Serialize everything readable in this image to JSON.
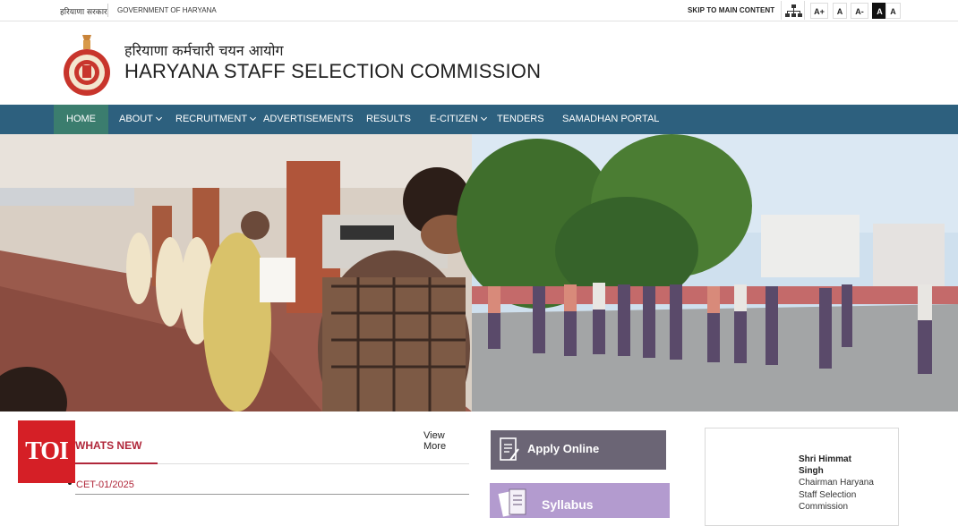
{
  "topbar": {
    "gov_hindi": "हरियाणा सरकार",
    "gov_english": "GOVERNMENT OF HARYANA",
    "skip_link": "SKIP TO MAIN CONTENT",
    "font_increase": "A+",
    "font_normal": "A",
    "font_decrease": "A-",
    "contrast_dark": "A",
    "contrast_light": "A"
  },
  "header": {
    "title_hindi": "हरियाणा कर्मचारी चयन आयोग",
    "title_english": "HARYANA STAFF SELECTION COMMISSION"
  },
  "nav": {
    "items": [
      {
        "label": "HOME",
        "active": true
      },
      {
        "label": "ABOUT",
        "dropdown": true
      },
      {
        "label": "RECRUITMENT",
        "dropdown": true
      },
      {
        "label": "ADVERTISEMENTS"
      },
      {
        "label": "RESULTS"
      },
      {
        "label": "E-CITIZEN",
        "dropdown": true
      },
      {
        "label": "TENDERS"
      },
      {
        "label": "SAMADHAN PORTAL"
      }
    ]
  },
  "banner": {
    "controls": [
      "prev-icon",
      "pause-icon",
      "next-icon"
    ]
  },
  "news": {
    "title": "WHATS NEW",
    "view_more": "View More",
    "items": [
      "CET-01/2025"
    ]
  },
  "overlay_badge": "TOI",
  "tiles": {
    "apply_online": "Apply Online",
    "syllabus": "Syllabus"
  },
  "chairman": {
    "name": "Shri Himmat Singh",
    "role": "Chairman Haryana Staff Selection Commission"
  },
  "colors": {
    "nav_bg": "#2d607e",
    "nav_active": "#3b7d6e",
    "accent_red": "#b0273a",
    "apply_tile": "#6b6575",
    "syllabus_tile": "#b39bcf",
    "toi_red": "#d51f26"
  }
}
